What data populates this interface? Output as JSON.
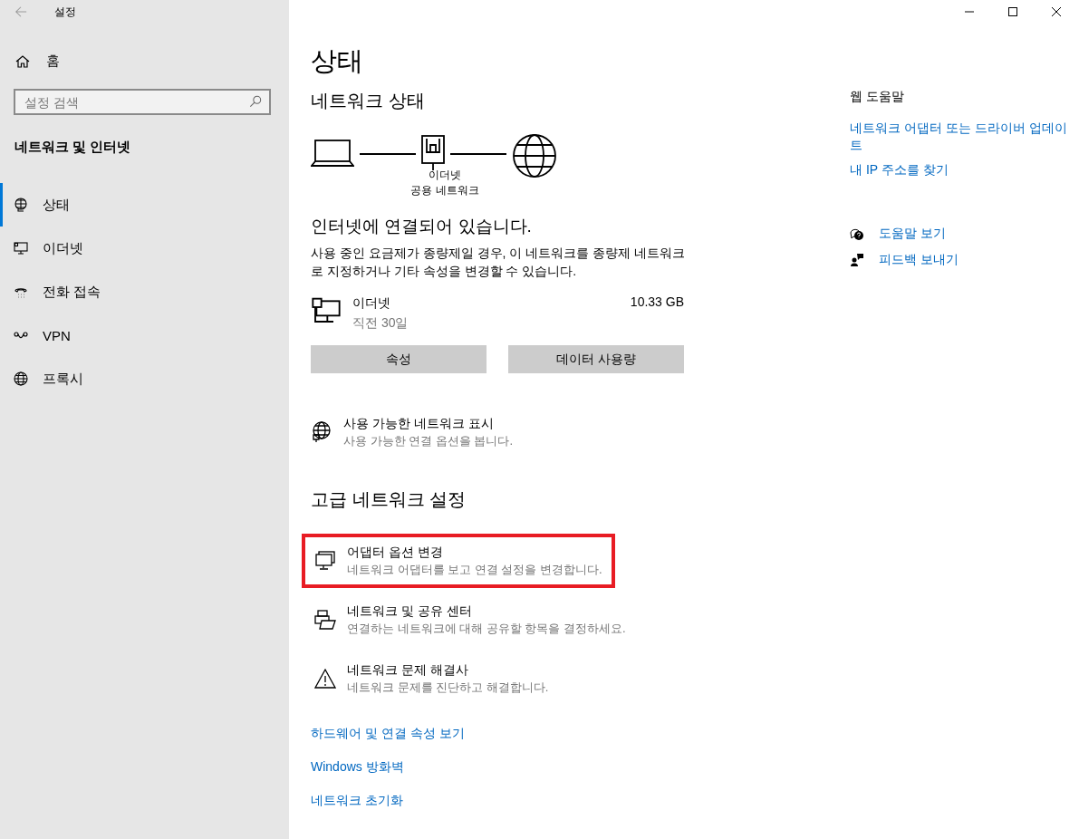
{
  "window": {
    "title": "설정"
  },
  "sidebar": {
    "home": "홈",
    "search": {
      "placeholder": "설정 검색"
    },
    "section": "네트워크 및 인터넷",
    "items": [
      {
        "label": "상태",
        "kind": "status",
        "selected": true
      },
      {
        "label": "이더넷",
        "kind": "ethernet",
        "selected": false
      },
      {
        "label": "전화 접속",
        "kind": "dialup",
        "selected": false
      },
      {
        "label": "VPN",
        "kind": "vpn",
        "selected": false
      },
      {
        "label": "프록시",
        "kind": "proxy",
        "selected": false
      }
    ]
  },
  "main": {
    "title": "상태",
    "network_status": {
      "heading": "네트워크 상태",
      "diagram_labels": [
        "이더넷",
        "공용 네트워크"
      ],
      "connected": "인터넷에 연결되어 있습니다.",
      "description": "사용 중인 요금제가 종량제일 경우, 이 네트워크를 종량제 네트워크로 지정하거나 기타 속성을 변경할 수 있습니다.",
      "adapter": {
        "name": "이더넷",
        "period": "직전 30일",
        "usage": "10.33 GB"
      },
      "buttons": [
        "속성",
        "데이터 사용량"
      ]
    },
    "show_networks": {
      "title": "사용 가능한 네트워크 표시",
      "subtitle": "사용 가능한 연결 옵션을 봅니다."
    },
    "advanced": {
      "heading": "고급 네트워크 설정",
      "items": [
        {
          "kind": "adapter",
          "title": "어댑터 옵션 변경",
          "subtitle": "네트워크 어댑터를 보고 연결 설정을 변경합니다.",
          "highlighted": true
        },
        {
          "kind": "sharing",
          "title": "네트워크 및 공유 센터",
          "subtitle": "연결하는 네트워크에 대해 공유할 항목을 결정하세요.",
          "highlighted": false
        },
        {
          "kind": "troubleshoot",
          "title": "네트워크 문제 해결사",
          "subtitle": "네트워크 문제를 진단하고 해결합니다.",
          "highlighted": false
        }
      ]
    },
    "links": [
      "하드웨어 및 연결 속성 보기",
      "Windows 방화벽",
      "네트워크 초기화"
    ]
  },
  "aside": {
    "heading": "웹 도움말",
    "links": [
      "네트워크 어댑터 또는 드라이버 업데이트",
      "내 IP 주소를 찾기"
    ],
    "actions": [
      {
        "kind": "help",
        "label": "도움말 보기"
      },
      {
        "kind": "feedback",
        "label": "피드백 보내기"
      }
    ]
  }
}
